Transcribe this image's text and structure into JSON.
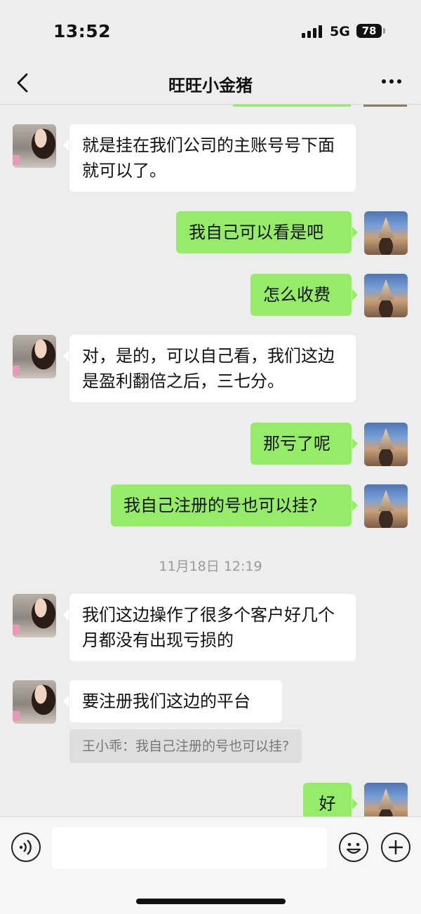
{
  "status_bar": {
    "time": "13:52",
    "network": "5G",
    "battery": "78"
  },
  "nav": {
    "title": "旺旺小金猪"
  },
  "messages": [
    {
      "side": "left",
      "text": "就是挂在我们公司的主账号号下面就可以了。"
    },
    {
      "side": "right",
      "text": "我自己可以看是吧"
    },
    {
      "side": "right",
      "text": "怎么收费"
    },
    {
      "side": "left",
      "text": "对，是的，可以自己看，我们这边是盈利翻倍之后，三七分。"
    },
    {
      "side": "right",
      "text": "那亏了呢"
    },
    {
      "side": "right",
      "text": "我自己注册的号也可以挂?"
    },
    {
      "side": "left",
      "text": "我们这边操作了很多个客户好几个月都没有出现亏损的"
    },
    {
      "side": "left",
      "text": "要注册我们这边的平台"
    },
    {
      "side": "right",
      "text": "好"
    }
  ],
  "timestamp": "11月18日 12:19",
  "quote": "王小乖：我自己注册的号也可以挂?",
  "icons": {
    "back": "chevron-left-icon",
    "more": "more-dots-icon",
    "voice": "voice-icon",
    "emoji": "emoji-icon",
    "add": "plus-icon"
  }
}
